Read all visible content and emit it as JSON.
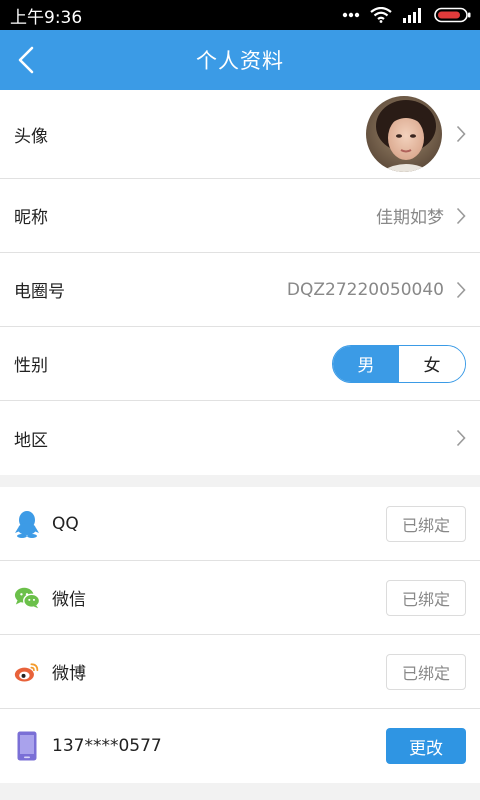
{
  "status_bar": {
    "time": "上午9:36",
    "icons": [
      "dots-icon",
      "wifi-icon",
      "signal-icon",
      "battery-icon"
    ]
  },
  "nav": {
    "title": "个人资料",
    "back_icon": "chevron-left-icon"
  },
  "profile": {
    "avatar_label": "头像",
    "nickname_label": "昵称",
    "nickname_value": "佳期如梦",
    "id_label": "电圈号",
    "id_value": "DQZ27220050040",
    "gender_label": "性别",
    "gender_options": [
      "男",
      "女"
    ],
    "gender_selected": "男",
    "region_label": "地区"
  },
  "bindings": [
    {
      "name": "QQ",
      "status": "已绑定",
      "icon": "qq-icon"
    },
    {
      "name": "微信",
      "status": "已绑定",
      "icon": "wechat-icon"
    },
    {
      "name": "微博",
      "status": "已绑定",
      "icon": "weibo-icon"
    }
  ],
  "phone": {
    "number": "137****0577",
    "button": "更改",
    "icon": "phone-icon"
  },
  "colors": {
    "accent": "#3b9be6",
    "qq": "#3d9be6",
    "wechat": "#6bc04a",
    "weibo": "#e8623a",
    "phone": "#7a6fd6"
  }
}
